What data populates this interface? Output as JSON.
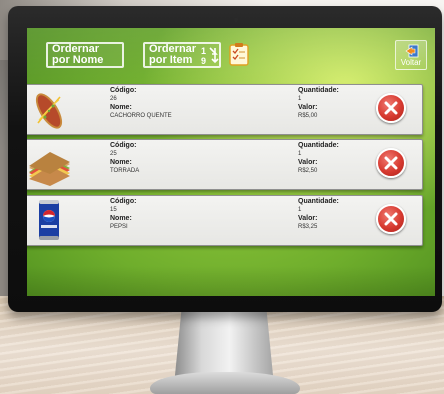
{
  "toolbar": {
    "sort_by_name": [
      "Ordernar",
      "por Nome"
    ],
    "sort_by_item": [
      "Ordernar",
      "por Item"
    ],
    "back_label": "Voltar"
  },
  "labels": {
    "code": "Código:",
    "name": "Nome:",
    "quantity": "Quantidade:",
    "value": "Valor:"
  },
  "items": [
    {
      "code": "26",
      "name": "CACHORRO QUENTE",
      "quantity": "1",
      "value": "R$5,00",
      "image_icon": "hot-dog-icon"
    },
    {
      "code": "25",
      "name": "TORRADA",
      "quantity": "1",
      "value": "R$2,50",
      "image_icon": "toast-sandwich-icon"
    },
    {
      "code": "15",
      "name": "PEPSI",
      "quantity": "1",
      "value": "R$3,25",
      "image_icon": "soda-can-icon"
    }
  ],
  "colors": {
    "screen_green": "#7fbe34",
    "delete_red": "#d73a30"
  }
}
